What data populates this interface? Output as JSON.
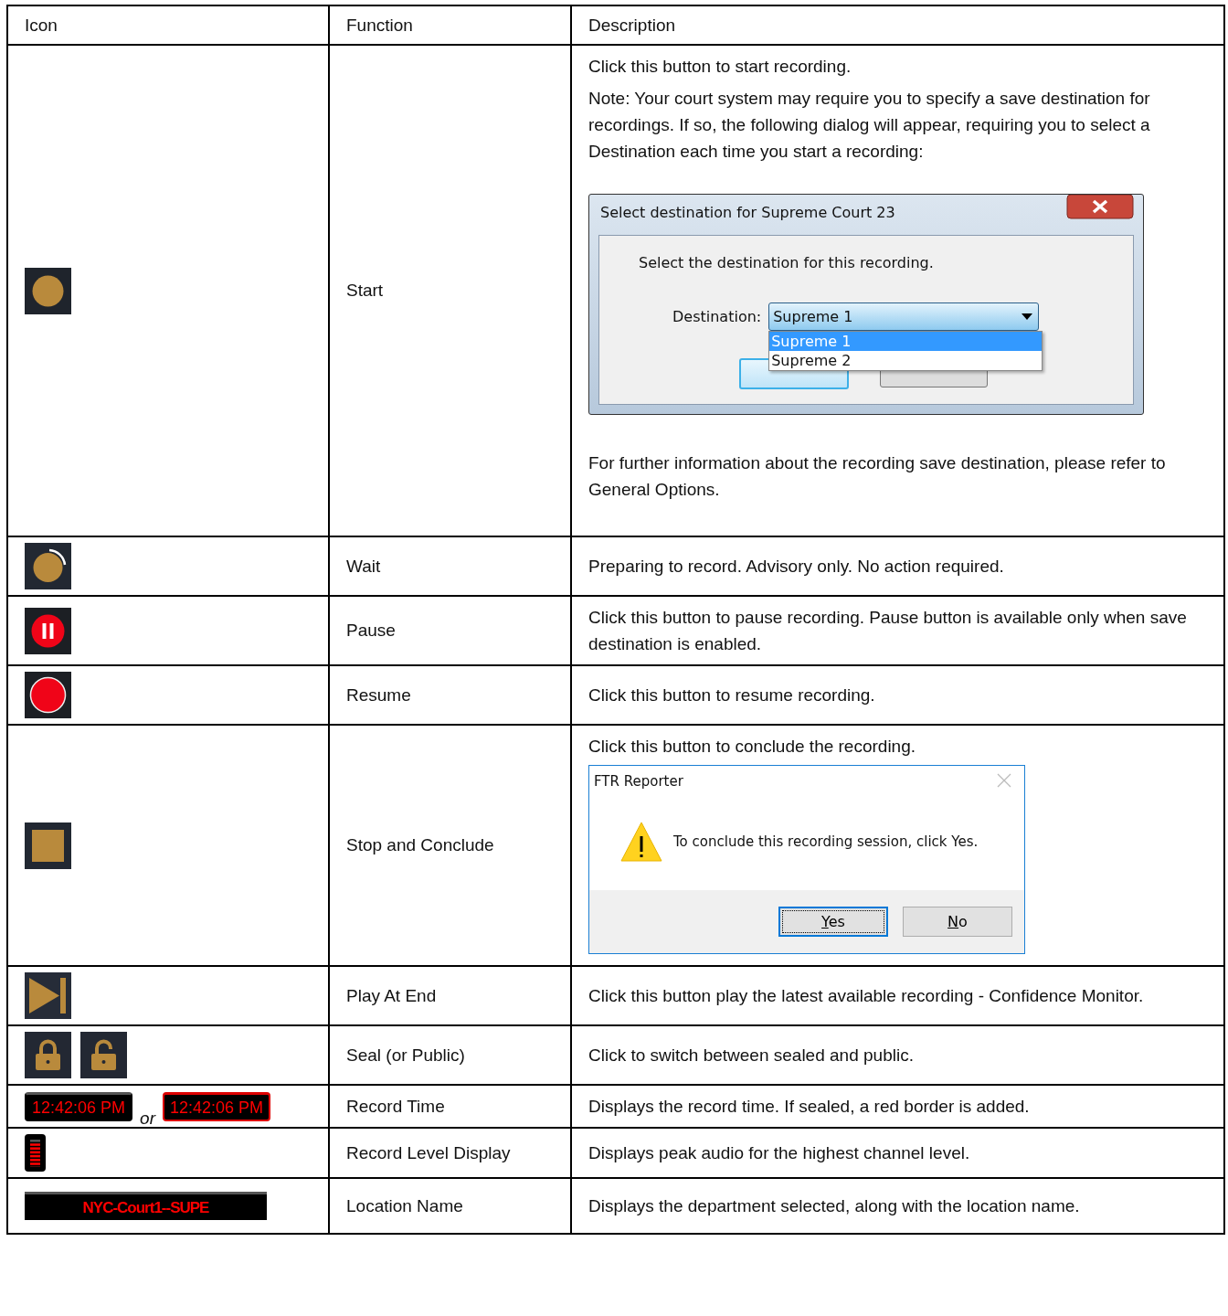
{
  "table": {
    "columns": [
      "Icon",
      "Function",
      "Description"
    ],
    "rows": [
      {
        "icons": [
          {
            "kind": "start"
          }
        ],
        "function": "Start",
        "description": [
          {
            "kind": "text",
            "text": "Click this button to start recording."
          },
          {
            "kind": "text",
            "text": "Note: Your court system may require you to specify a save destination for recordings. If so, the following dialog will appear, requiring you to select a Destination each time you start a recording:"
          },
          {
            "kind": "destination_dialog",
            "title": "Select destination for Supreme Court 23",
            "prompt": "Select the destination for this recording.",
            "label": "Destination:",
            "value": "Supreme 1",
            "options": [
              {
                "label": "Supreme 1",
                "selected": true
              },
              {
                "label": "Supreme 2",
                "selected": false
              }
            ]
          },
          {
            "kind": "text",
            "text": "For further information about the recording save destination, please refer to General Options."
          }
        ]
      },
      {
        "icons": [
          {
            "kind": "wait"
          }
        ],
        "function": "Wait",
        "description": [
          {
            "kind": "text",
            "text": "Preparing to record. Advisory only. No action required."
          }
        ]
      },
      {
        "icons": [
          {
            "kind": "pause"
          }
        ],
        "function": "Pause",
        "description": [
          {
            "kind": "text",
            "text": "Click this button to pause recording. Pause button is available only when save destination is enabled."
          }
        ]
      },
      {
        "icons": [
          {
            "kind": "resume"
          }
        ],
        "function": "Resume",
        "description": [
          {
            "kind": "text",
            "text": "Click this button to resume recording."
          }
        ]
      },
      {
        "icons": [
          {
            "kind": "stop"
          }
        ],
        "function": "Stop and Conclude",
        "description": [
          {
            "kind": "text",
            "text": "Click this button to conclude the recording."
          },
          {
            "kind": "confirm_dialog",
            "title": "FTR Reporter",
            "message": "To conclude this recording session, click Yes.",
            "buttons": [
              {
                "label": "Yes",
                "focused": true
              },
              {
                "label": "No",
                "focused": false
              }
            ]
          }
        ]
      },
      {
        "icons": [
          {
            "kind": "play_end"
          }
        ],
        "function": "Play At End",
        "description": [
          {
            "kind": "text",
            "text": "Click this button play the latest available recording - Confidence Monitor."
          }
        ]
      },
      {
        "icons": [
          {
            "kind": "lock",
            "locked": true
          },
          {
            "kind": "lock",
            "locked": false
          }
        ],
        "function": "Seal (or Public)",
        "description": [
          {
            "kind": "text",
            "text": "Click to switch between sealed and public."
          }
        ]
      },
      {
        "icons": [
          {
            "kind": "clock",
            "text": "12:42:06 PM",
            "sealed": false
          },
          {
            "kind": "word",
            "text": "or"
          },
          {
            "kind": "clock",
            "text": "12:42:06 PM",
            "sealed": true
          }
        ],
        "function": "Record Time",
        "description": [
          {
            "kind": "text",
            "text": "Displays the record time.  If sealed, a red border is added."
          }
        ]
      },
      {
        "icons": [
          {
            "kind": "meter",
            "level": 0.86
          }
        ],
        "function": "Record Level Display",
        "description": [
          {
            "kind": "text",
            "text": "Displays peak audio for the highest channel level."
          }
        ]
      },
      {
        "icons": [
          {
            "kind": "location",
            "text": "NYC-Court1--SUPE"
          }
        ],
        "function": "Location Name",
        "description": [
          {
            "kind": "text",
            "text": "Displays the department selected, along with the location name."
          }
        ]
      }
    ]
  }
}
